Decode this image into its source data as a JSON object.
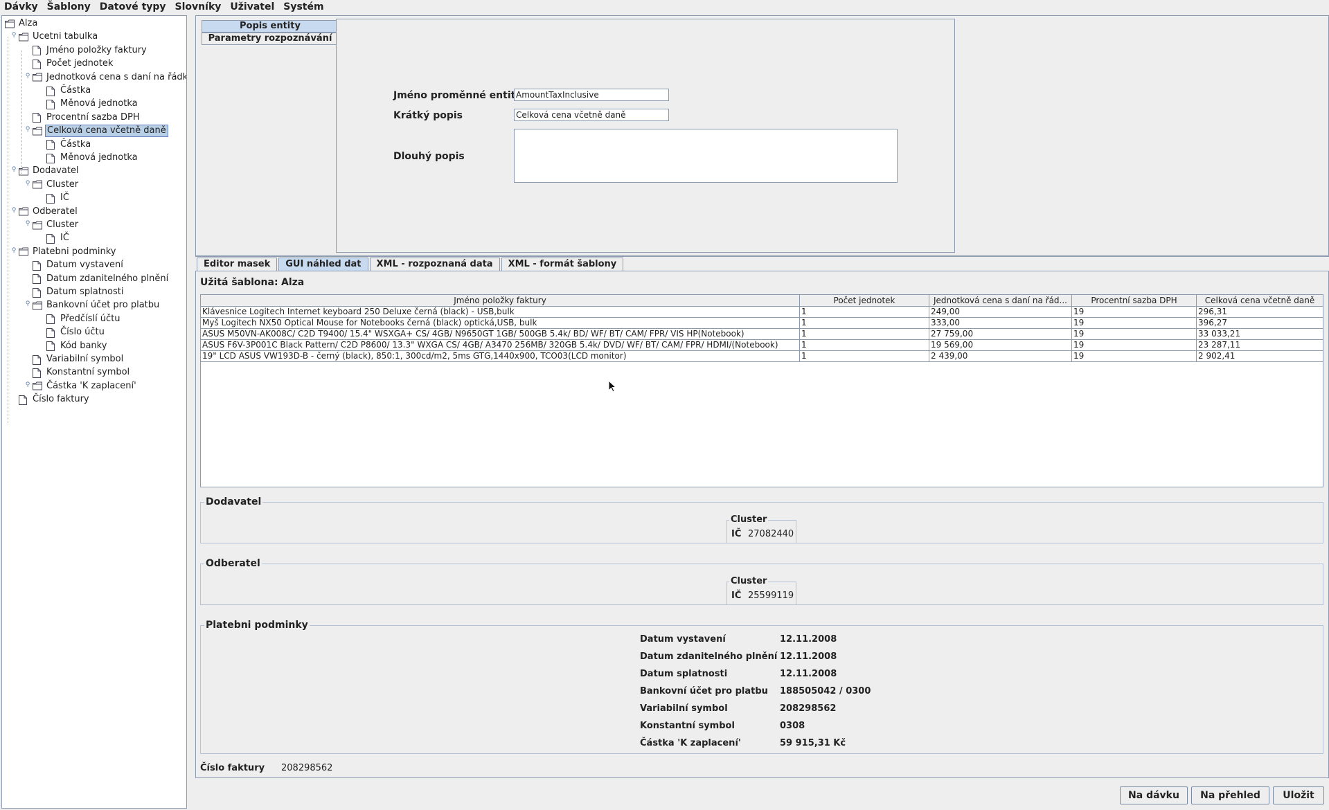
{
  "menu": [
    "Dávky",
    "Šablony",
    "Datové typy",
    "Slovníky",
    "Uživatel",
    "Systém"
  ],
  "tree": {
    "nodes": [
      {
        "label": "Alza",
        "type": "folder",
        "level": 0
      },
      {
        "label": "Ucetni tabulka",
        "type": "folder",
        "level": 1
      },
      {
        "label": "Jméno položky faktury",
        "type": "file",
        "level": 2
      },
      {
        "label": "Počet jednotek",
        "type": "file",
        "level": 2
      },
      {
        "label": "Jednotková cena s daní na řádku",
        "type": "folder",
        "level": 2
      },
      {
        "label": "Částka",
        "type": "file",
        "level": 3
      },
      {
        "label": "Měnová jednotka",
        "type": "file",
        "level": 3
      },
      {
        "label": "Procentní sazba DPH",
        "type": "file",
        "level": 2
      },
      {
        "label": "Celková cena včetně daně",
        "type": "folder",
        "level": 2,
        "selected": true
      },
      {
        "label": "Částka",
        "type": "file",
        "level": 3
      },
      {
        "label": "Měnová jednotka",
        "type": "file",
        "level": 3
      },
      {
        "label": "Dodavatel",
        "type": "folder",
        "level": 1
      },
      {
        "label": "Cluster",
        "type": "folder",
        "level": 2
      },
      {
        "label": "IČ",
        "type": "file",
        "level": 3
      },
      {
        "label": "Odberatel",
        "type": "folder",
        "level": 1
      },
      {
        "label": "Cluster",
        "type": "folder",
        "level": 2
      },
      {
        "label": "IČ",
        "type": "file",
        "level": 3
      },
      {
        "label": "Platebni podminky",
        "type": "folder",
        "level": 1
      },
      {
        "label": "Datum vystavení",
        "type": "file",
        "level": 2
      },
      {
        "label": "Datum zdanitelného plnění",
        "type": "file",
        "level": 2
      },
      {
        "label": "Datum splatnosti",
        "type": "file",
        "level": 2
      },
      {
        "label": "Bankovní účet pro platbu",
        "type": "folder",
        "level": 2
      },
      {
        "label": "Předčíslí účtu",
        "type": "file",
        "level": 3
      },
      {
        "label": "Číslo účtu",
        "type": "file",
        "level": 3
      },
      {
        "label": "Kód banky",
        "type": "file",
        "level": 3
      },
      {
        "label": "Variabilní symbol",
        "type": "file",
        "level": 2
      },
      {
        "label": "Konstantní symbol",
        "type": "file",
        "level": 2
      },
      {
        "label": "Částka 'K zaplacení'",
        "type": "folder",
        "level": 2
      },
      {
        "label": "Číslo faktury",
        "type": "file",
        "level": 1
      }
    ]
  },
  "entity": {
    "tab_description": "Popis entity",
    "tab_recognition": "Parametry rozpoznávání",
    "var_name_label": "Jméno proměnné entity",
    "var_name_value": "AmountTaxInclusive",
    "short_desc_label": "Krátký popis",
    "short_desc_value": "Celková cena včetně daně",
    "long_desc_label": "Dlouhý popis",
    "long_desc_value": ""
  },
  "tabs": [
    "Editor masek",
    "GUI náhled dat",
    "XML - rozpoznaná data",
    "XML - formát šablony"
  ],
  "used_template": {
    "label": "Užitá šablona:",
    "value": "Alza"
  },
  "table": {
    "columns": [
      "Jméno položky faktury",
      "Počet jednotek",
      "Jednotková cena s daní na řád...",
      "Procentní sazba DPH",
      "Celková cena včetně daně"
    ],
    "rows": [
      [
        "Klávesnice Logitech Internet keyboard 250 Deluxe černá (black) - USB,bulk",
        "1",
        "249,00",
        "19",
        "296,31"
      ],
      [
        "Myš Logitech NX50 Optical Mouse for Notebooks černá (black) optická,USB, bulk",
        "1",
        "333,00",
        "19",
        "396,27"
      ],
      [
        "ASUS M50VN-AK008C/ C2D T9400/ 15.4\" WSXGA+ CS/ 4GB/            N9650GT 1GB/ 500GB 5.4k/ BD/ WF/ BT/ CAM/ FPR/ VIS HP(Notebook)",
        "1",
        "27 759,00",
        "19",
        "33 033,21"
      ],
      [
        "ASUS F6V-3P001C Black Pattern/ C2D P8600/ 13.3\" WXGA CS/ 4GB/  A3470 256MB/ 320GB 5.4k/ DVD/ WF/ BT/ CAM/ FPR/ HDMI/(Notebook)",
        "1",
        "19 569,00",
        "19",
        "23 287,11"
      ],
      [
        "19\" LCD ASUS VW193D-B - černý (black), 850:1, 300cd/m2, 5ms GTG,1440x900, TCO03(LCD monitor)",
        "1",
        "2 439,00",
        "19",
        "2 902,41"
      ]
    ]
  },
  "supplier": {
    "title": "Dodavatel",
    "cluster_title": "Cluster",
    "ic_label": "IČ",
    "ic_value": "27082440"
  },
  "customer": {
    "title": "Odberatel",
    "cluster_title": "Cluster",
    "ic_label": "IČ",
    "ic_value": "25599119"
  },
  "payment": {
    "title": "Platebni podminky",
    "rows": [
      {
        "label": "Datum vystavení",
        "value": "12.11.2008"
      },
      {
        "label": "Datum zdanitelného plnění",
        "value": "12.11.2008"
      },
      {
        "label": "Datum splatnosti",
        "value": "12.11.2008"
      },
      {
        "label": "Bankovní účet pro platbu",
        "value": "188505042 / 0300"
      },
      {
        "label": "Variabilní symbol",
        "value": "208298562"
      },
      {
        "label": "Konstantní symbol",
        "value": "0308"
      },
      {
        "label": "Částka 'K zaplacení'",
        "value": "59 915,31 Kč"
      }
    ]
  },
  "invoice": {
    "label": "Číslo faktury",
    "value": "208298562"
  },
  "buttons": {
    "to_batch": "Na dávku",
    "to_overview": "Na přehled",
    "save": "Uložit"
  }
}
